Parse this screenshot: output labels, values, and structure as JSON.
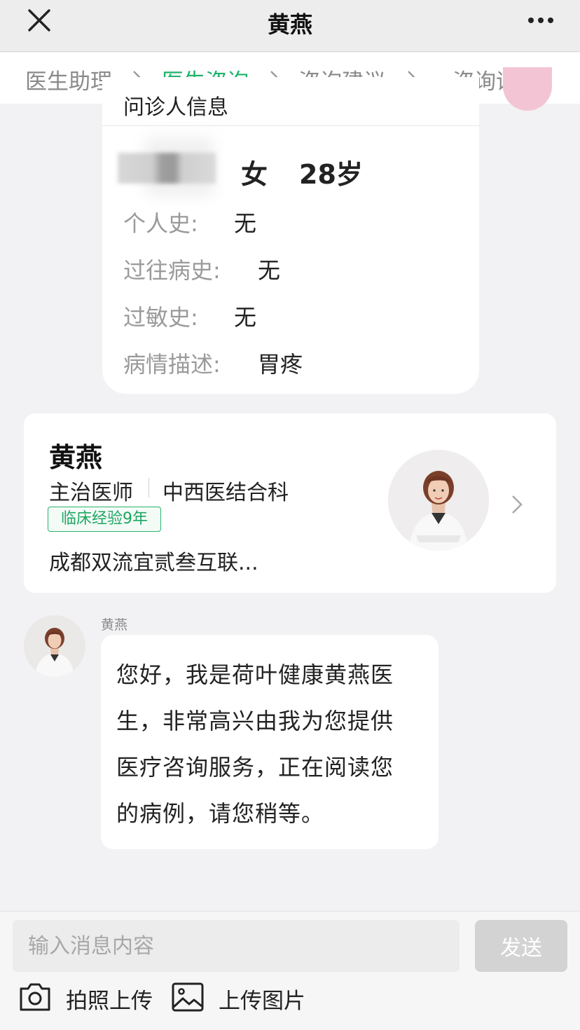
{
  "header": {
    "title": "黄燕",
    "close_icon": "close-icon",
    "more_icon": "more-icon"
  },
  "steps": {
    "items": [
      {
        "label": "医生助理",
        "active": false
      },
      {
        "label": "医生咨询",
        "active": true
      },
      {
        "label": "咨询建议",
        "active": false
      },
      {
        "label": "咨询评价",
        "active": false
      }
    ],
    "active_color": "#1fb36b",
    "inactive_color": "#8a8a8a"
  },
  "patient_card": {
    "header_label": "问诊人信息",
    "gender": "女",
    "age": "28岁",
    "fields": [
      {
        "label": "个人史:",
        "value": "无"
      },
      {
        "label": "过往病史:",
        "value": "无"
      },
      {
        "label": "过敏史:",
        "value": "无"
      },
      {
        "label": "病情描述:",
        "value": "胃疼"
      }
    ]
  },
  "doctor_card": {
    "name": "黄燕",
    "title": "主治医师",
    "department": "中西医结合科",
    "badge": "临床经验9年",
    "hospital": "成都双流宜贰叁互联...",
    "badge_color": "#2bb36d"
  },
  "chat": {
    "sender": "黄燕",
    "message": "您好，我是荷叶健康黄燕医生，非常高兴由我为您提供医疗咨询服务，正在阅读您的病例，请您稍等。"
  },
  "composer": {
    "placeholder": "输入消息内容",
    "send_label": "发送",
    "take_photo_label": "拍照上传",
    "upload_image_label": "上传图片"
  }
}
